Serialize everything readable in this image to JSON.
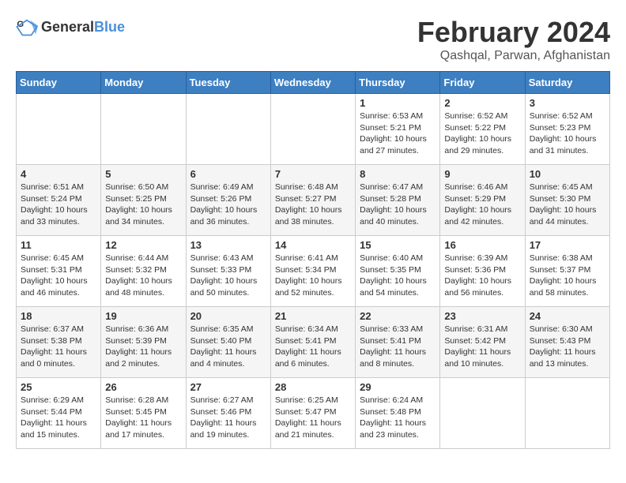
{
  "header": {
    "logo_general": "General",
    "logo_blue": "Blue",
    "month_year": "February 2024",
    "location": "Qashqal, Parwan, Afghanistan"
  },
  "days_of_week": [
    "Sunday",
    "Monday",
    "Tuesday",
    "Wednesday",
    "Thursday",
    "Friday",
    "Saturday"
  ],
  "weeks": [
    [
      {
        "day": "",
        "info": ""
      },
      {
        "day": "",
        "info": ""
      },
      {
        "day": "",
        "info": ""
      },
      {
        "day": "",
        "info": ""
      },
      {
        "day": "1",
        "info": "Sunrise: 6:53 AM\nSunset: 5:21 PM\nDaylight: 10 hours\nand 27 minutes."
      },
      {
        "day": "2",
        "info": "Sunrise: 6:52 AM\nSunset: 5:22 PM\nDaylight: 10 hours\nand 29 minutes."
      },
      {
        "day": "3",
        "info": "Sunrise: 6:52 AM\nSunset: 5:23 PM\nDaylight: 10 hours\nand 31 minutes."
      }
    ],
    [
      {
        "day": "4",
        "info": "Sunrise: 6:51 AM\nSunset: 5:24 PM\nDaylight: 10 hours\nand 33 minutes."
      },
      {
        "day": "5",
        "info": "Sunrise: 6:50 AM\nSunset: 5:25 PM\nDaylight: 10 hours\nand 34 minutes."
      },
      {
        "day": "6",
        "info": "Sunrise: 6:49 AM\nSunset: 5:26 PM\nDaylight: 10 hours\nand 36 minutes."
      },
      {
        "day": "7",
        "info": "Sunrise: 6:48 AM\nSunset: 5:27 PM\nDaylight: 10 hours\nand 38 minutes."
      },
      {
        "day": "8",
        "info": "Sunrise: 6:47 AM\nSunset: 5:28 PM\nDaylight: 10 hours\nand 40 minutes."
      },
      {
        "day": "9",
        "info": "Sunrise: 6:46 AM\nSunset: 5:29 PM\nDaylight: 10 hours\nand 42 minutes."
      },
      {
        "day": "10",
        "info": "Sunrise: 6:45 AM\nSunset: 5:30 PM\nDaylight: 10 hours\nand 44 minutes."
      }
    ],
    [
      {
        "day": "11",
        "info": "Sunrise: 6:45 AM\nSunset: 5:31 PM\nDaylight: 10 hours\nand 46 minutes."
      },
      {
        "day": "12",
        "info": "Sunrise: 6:44 AM\nSunset: 5:32 PM\nDaylight: 10 hours\nand 48 minutes."
      },
      {
        "day": "13",
        "info": "Sunrise: 6:43 AM\nSunset: 5:33 PM\nDaylight: 10 hours\nand 50 minutes."
      },
      {
        "day": "14",
        "info": "Sunrise: 6:41 AM\nSunset: 5:34 PM\nDaylight: 10 hours\nand 52 minutes."
      },
      {
        "day": "15",
        "info": "Sunrise: 6:40 AM\nSunset: 5:35 PM\nDaylight: 10 hours\nand 54 minutes."
      },
      {
        "day": "16",
        "info": "Sunrise: 6:39 AM\nSunset: 5:36 PM\nDaylight: 10 hours\nand 56 minutes."
      },
      {
        "day": "17",
        "info": "Sunrise: 6:38 AM\nSunset: 5:37 PM\nDaylight: 10 hours\nand 58 minutes."
      }
    ],
    [
      {
        "day": "18",
        "info": "Sunrise: 6:37 AM\nSunset: 5:38 PM\nDaylight: 11 hours\nand 0 minutes."
      },
      {
        "day": "19",
        "info": "Sunrise: 6:36 AM\nSunset: 5:39 PM\nDaylight: 11 hours\nand 2 minutes."
      },
      {
        "day": "20",
        "info": "Sunrise: 6:35 AM\nSunset: 5:40 PM\nDaylight: 11 hours\nand 4 minutes."
      },
      {
        "day": "21",
        "info": "Sunrise: 6:34 AM\nSunset: 5:41 PM\nDaylight: 11 hours\nand 6 minutes."
      },
      {
        "day": "22",
        "info": "Sunrise: 6:33 AM\nSunset: 5:41 PM\nDaylight: 11 hours\nand 8 minutes."
      },
      {
        "day": "23",
        "info": "Sunrise: 6:31 AM\nSunset: 5:42 PM\nDaylight: 11 hours\nand 10 minutes."
      },
      {
        "day": "24",
        "info": "Sunrise: 6:30 AM\nSunset: 5:43 PM\nDaylight: 11 hours\nand 13 minutes."
      }
    ],
    [
      {
        "day": "25",
        "info": "Sunrise: 6:29 AM\nSunset: 5:44 PM\nDaylight: 11 hours\nand 15 minutes."
      },
      {
        "day": "26",
        "info": "Sunrise: 6:28 AM\nSunset: 5:45 PM\nDaylight: 11 hours\nand 17 minutes."
      },
      {
        "day": "27",
        "info": "Sunrise: 6:27 AM\nSunset: 5:46 PM\nDaylight: 11 hours\nand 19 minutes."
      },
      {
        "day": "28",
        "info": "Sunrise: 6:25 AM\nSunset: 5:47 PM\nDaylight: 11 hours\nand 21 minutes."
      },
      {
        "day": "29",
        "info": "Sunrise: 6:24 AM\nSunset: 5:48 PM\nDaylight: 11 hours\nand 23 minutes."
      },
      {
        "day": "",
        "info": ""
      },
      {
        "day": "",
        "info": ""
      }
    ]
  ]
}
